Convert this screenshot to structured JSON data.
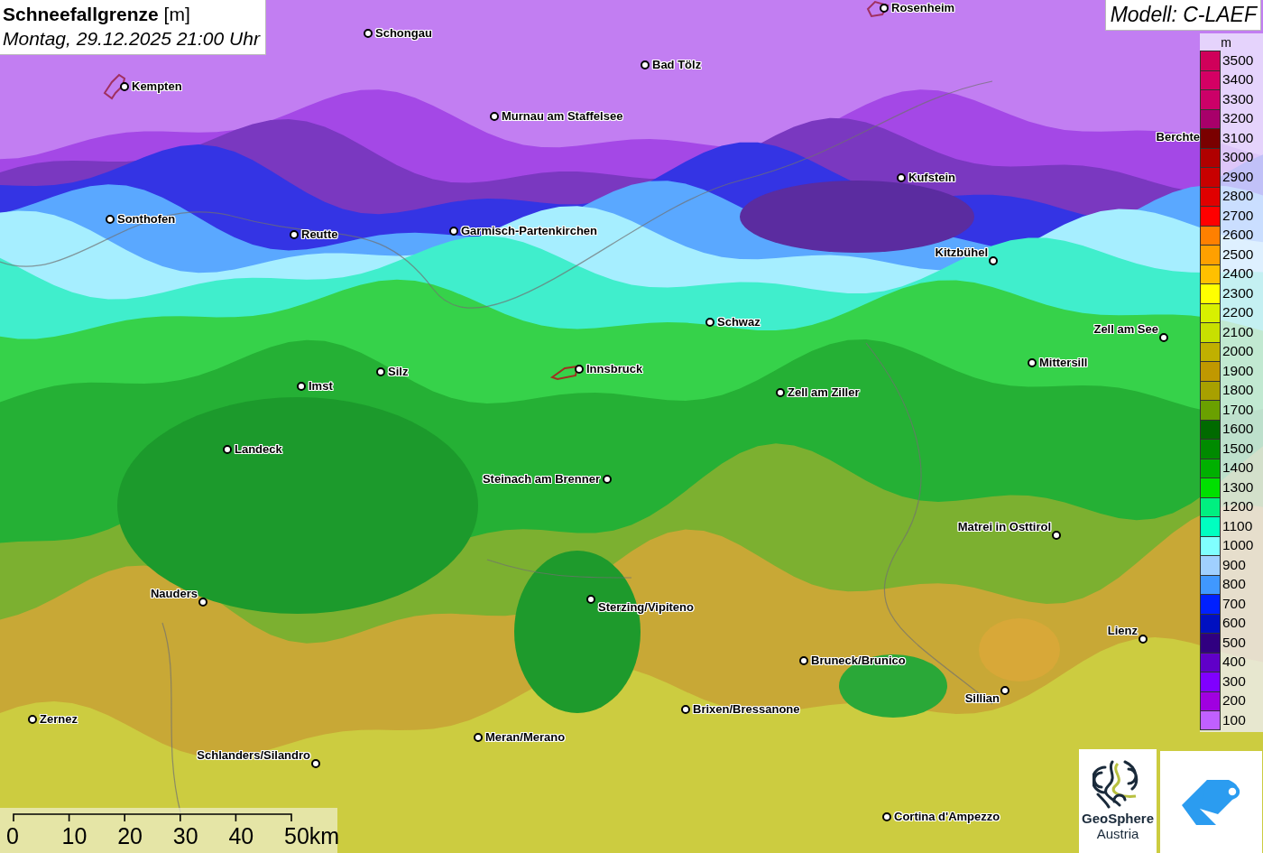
{
  "title": {
    "heading": "**Schneefallgrenze** [m]",
    "datetime": "Montag, 29.12.2025 21:00 Uhr"
  },
  "model": "Modell: C-LAEF",
  "cities": [
    {
      "name": "Rosenheim"
    },
    {
      "name": "Schongau"
    },
    {
      "name": "Bad Tölz"
    },
    {
      "name": "Kempten"
    },
    {
      "name": "Murnau am Staffelsee"
    },
    {
      "name": "Berchte"
    },
    {
      "name": "Kufstein"
    },
    {
      "name": "Sonthofen"
    },
    {
      "name": "Reutte"
    },
    {
      "name": "Garmisch-Partenkirchen"
    },
    {
      "name": "Kitzbühel"
    },
    {
      "name": "Schwaz"
    },
    {
      "name": "Zell am See"
    },
    {
      "name": "Mittersill"
    },
    {
      "name": "Innsbruck"
    },
    {
      "name": "Silz"
    },
    {
      "name": "Zell am Ziller"
    },
    {
      "name": "Imst"
    },
    {
      "name": "Landeck"
    },
    {
      "name": "Steinach am Brenner"
    },
    {
      "name": "Matrei in Osttirol"
    },
    {
      "name": "Nauders"
    },
    {
      "name": "Sterzing/Vipiteno"
    },
    {
      "name": "Lienz"
    },
    {
      "name": "Bruneck/Brunico"
    },
    {
      "name": "Sillian"
    },
    {
      "name": "Brixen/Bressanone"
    },
    {
      "name": "Zernez"
    },
    {
      "name": "Meran/Merano"
    },
    {
      "name": "Schlanders/Silandro"
    },
    {
      "name": "Cortina d'Ampezzo"
    }
  ],
  "legend": {
    "unit": "m",
    "items": [
      {
        "label": "3500",
        "color": "#d0005a"
      },
      {
        "label": "3400",
        "color": "#d40064"
      },
      {
        "label": "3300",
        "color": "#cc0068"
      },
      {
        "label": "3200",
        "color": "#a8006a"
      },
      {
        "label": "3100",
        "color": "#7a0000"
      },
      {
        "label": "3000",
        "color": "#b00000"
      },
      {
        "label": "2900",
        "color": "#c80000"
      },
      {
        "label": "2800",
        "color": "#e00000"
      },
      {
        "label": "2700",
        "color": "#ff0000"
      },
      {
        "label": "2600",
        "color": "#ff8000"
      },
      {
        "label": "2500",
        "color": "#ffa000"
      },
      {
        "label": "2400",
        "color": "#ffc000"
      },
      {
        "label": "2300",
        "color": "#ffff00"
      },
      {
        "label": "2200",
        "color": "#d8f000"
      },
      {
        "label": "2100",
        "color": "#c8e000"
      },
      {
        "label": "2000",
        "color": "#c0b000"
      },
      {
        "label": "1900",
        "color": "#c09800"
      },
      {
        "label": "1800",
        "color": "#a8a000"
      },
      {
        "label": "1700",
        "color": "#6aa000"
      },
      {
        "label": "1600",
        "color": "#006a00"
      },
      {
        "label": "1500",
        "color": "#008a00"
      },
      {
        "label": "1400",
        "color": "#00b000"
      },
      {
        "label": "1300",
        "color": "#00e000"
      },
      {
        "label": "1200",
        "color": "#00f080"
      },
      {
        "label": "1100",
        "color": "#00ffc0"
      },
      {
        "label": "1000",
        "color": "#80ffff"
      },
      {
        "label": "900",
        "color": "#a0d0ff"
      },
      {
        "label": "800",
        "color": "#4098ff"
      },
      {
        "label": "700",
        "color": "#0020ff"
      },
      {
        "label": "600",
        "color": "#0010c0"
      },
      {
        "label": "500",
        "color": "#300080"
      },
      {
        "label": "400",
        "color": "#6000c8"
      },
      {
        "label": "300",
        "color": "#8000ff"
      },
      {
        "label": "200",
        "color": "#a000e0"
      },
      {
        "label": "100",
        "color": "#c060ff"
      }
    ]
  },
  "scale": {
    "labels": [
      "0",
      "10",
      "20",
      "30",
      "40",
      "50km"
    ]
  },
  "logo": {
    "line1": "GeoSphere",
    "line2": "Austria"
  }
}
